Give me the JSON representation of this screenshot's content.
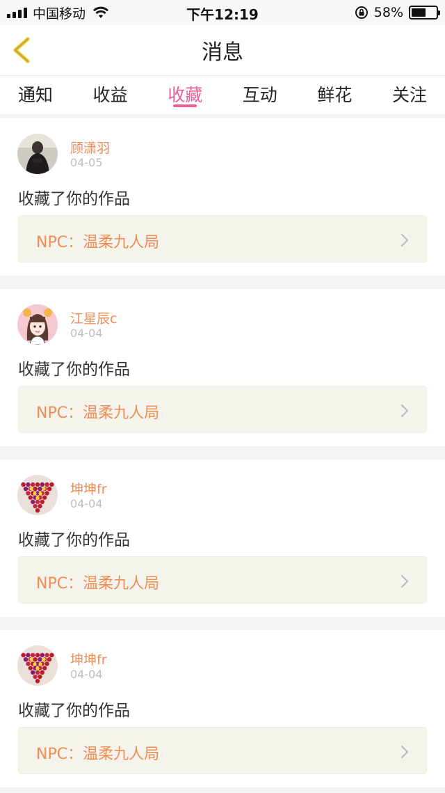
{
  "status_bar": {
    "carrier": "中国移动",
    "time": "下午12:19",
    "battery_percent": "58%",
    "battery_level": 0.58
  },
  "nav": {
    "title": "消息",
    "back_icon": "chevron-left-icon"
  },
  "tabs": [
    {
      "label": "通知",
      "active": false
    },
    {
      "label": "收益",
      "active": false
    },
    {
      "label": "收藏",
      "active": true
    },
    {
      "label": "互动",
      "active": false
    },
    {
      "label": "鲜花",
      "active": false
    },
    {
      "label": "关注",
      "active": false
    }
  ],
  "accent_color": "#e8619a",
  "name_color": "#ef8d55",
  "messages": [
    {
      "username": "顾潇羽",
      "date": "04-05",
      "action": "收藏了你的作品",
      "work_title": "NPC：温柔九人局"
    },
    {
      "username": "江星辰c",
      "date": "04-04",
      "action": "收藏了你的作品",
      "work_title": "NPC：温柔九人局"
    },
    {
      "username": "坤坤fr",
      "date": "04-04",
      "action": "收藏了你的作品",
      "work_title": "NPC：温柔九人局"
    },
    {
      "username": "坤坤fr",
      "date": "04-04",
      "action": "收藏了你的作品",
      "work_title": "NPC：温柔九人局"
    }
  ]
}
